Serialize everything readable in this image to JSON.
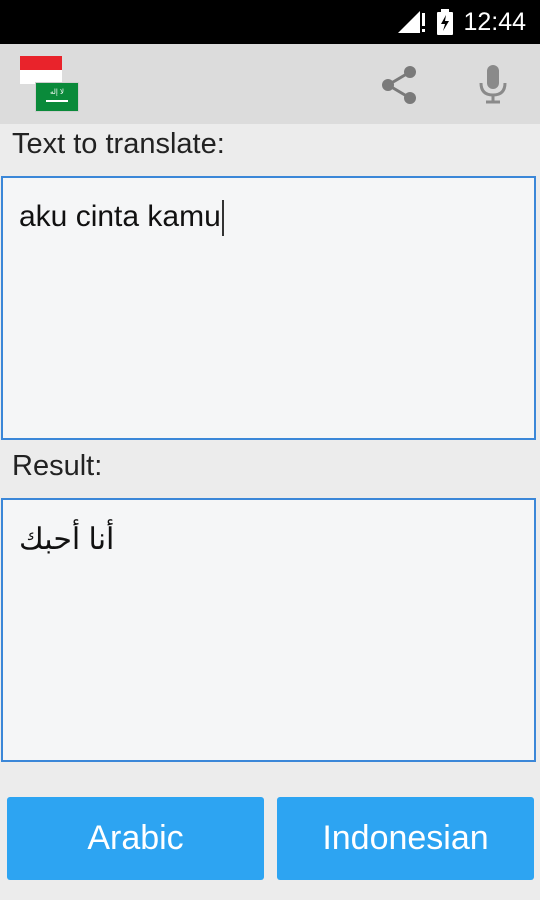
{
  "status_bar": {
    "time": "12:44"
  },
  "action_bar": {
    "flag_source": "Indonesia flag",
    "flag_target": "Saudi Arabia flag",
    "share_icon": "share-icon",
    "mic_icon": "microphone-icon"
  },
  "input_section": {
    "label": "Text to translate:",
    "value": "aku cinta kamu"
  },
  "result_section": {
    "label": "Result:",
    "value": "أنا أحبك"
  },
  "buttons": {
    "arabic": "Arabic",
    "indonesian": "Indonesian"
  },
  "colors": {
    "accent_blue": "#2da4f2",
    "border_blue": "#3b87d8",
    "flag_red": "#e9232b",
    "flag_green": "#0a8a3a"
  }
}
